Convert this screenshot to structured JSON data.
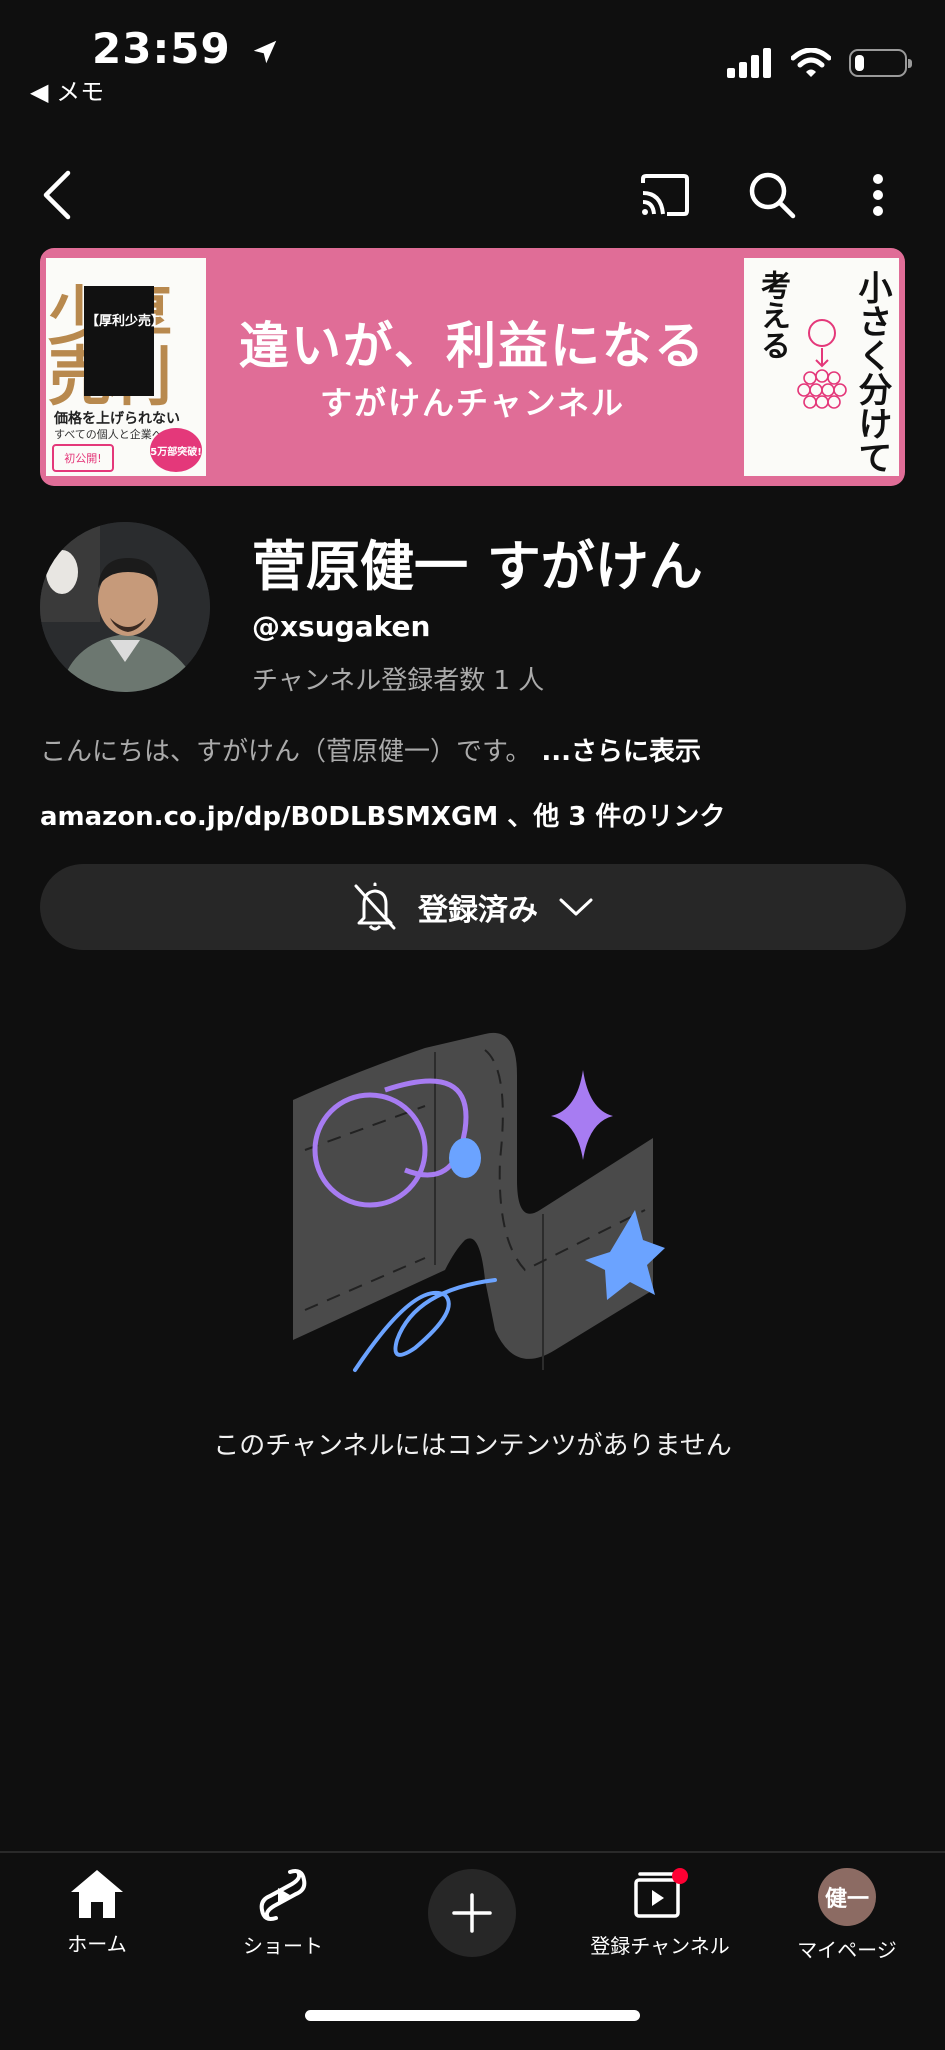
{
  "status_bar": {
    "time": "23:59",
    "back_app": "◀ メモ",
    "battery_level": 0.2
  },
  "top_bar": {
    "icons": [
      "back-arrow-icon",
      "cast-icon",
      "search-icon",
      "more-vert-icon"
    ]
  },
  "banner": {
    "title": "違いが、利益になる",
    "subtitle": "すがけんチャンネル",
    "book_left": {
      "big_text": "少厚売利",
      "tag": "【厚利少売】",
      "tagline": "価格を上げられない",
      "tagline2": "すべての個人と企業へ",
      "badge": "5万部突破!",
      "note": "初公開!"
    },
    "book_right": {
      "title1": "小さく分けて",
      "title2": "考える"
    },
    "background_color": "#e06d97"
  },
  "channel": {
    "name": "菅原健一 すがけん",
    "handle": "@xsugaken",
    "subscribers": "チャンネル登録者数 1 人",
    "description": "こんにちは、すがけん（菅原健一）です。",
    "description_more": "...さらに表示",
    "links": "amazon.co.jp/dp/B0DLBSMXGM 、他 3 件のリンク"
  },
  "subscribe_button": {
    "label": "登録済み"
  },
  "empty_state": {
    "message": "このチャンネルにはコンテンツがありません"
  },
  "bottom_nav": {
    "home": "ホーム",
    "shorts": "ショート",
    "subscriptions": "登録チャンネル",
    "me": "マイページ",
    "me_avatar_text": "健一"
  }
}
